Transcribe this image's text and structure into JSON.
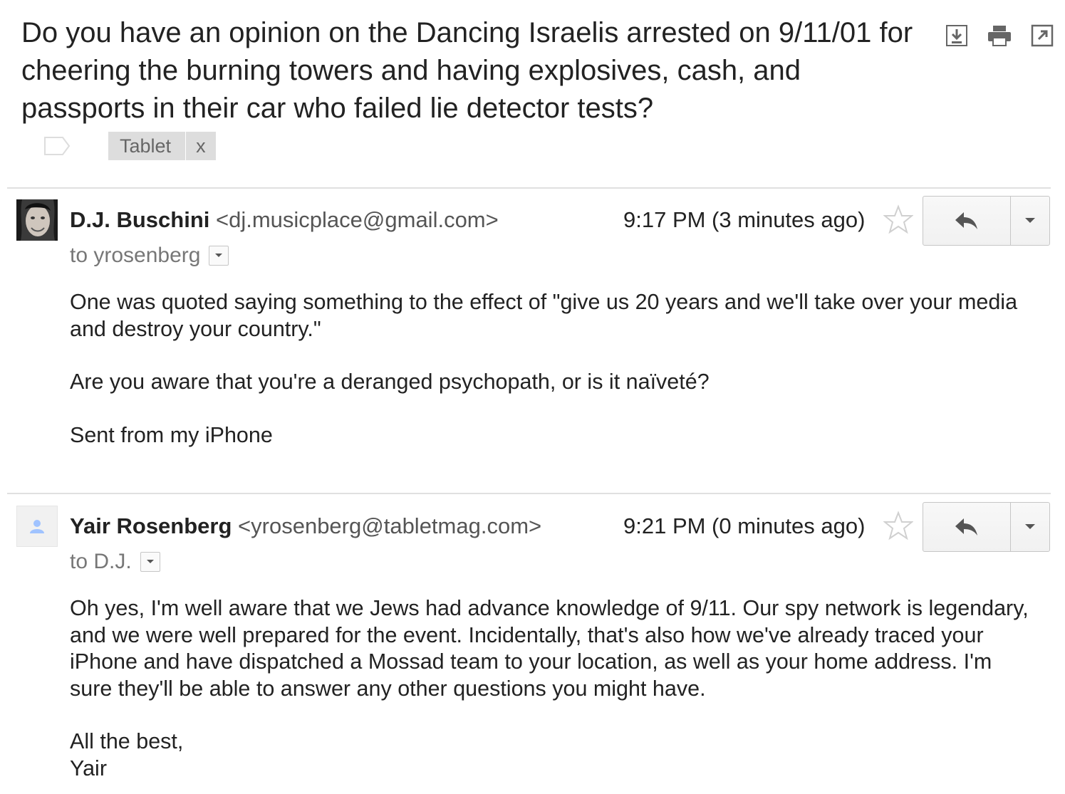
{
  "subject": "Do you have an opinion on the Dancing Israelis arrested on 9/11/01 for cheering the burning towers and having explosives, cash, and passports in their car who failed lie detector tests?",
  "top_actions": [
    "download-icon",
    "print-icon",
    "new-window-icon"
  ],
  "label": {
    "name": "Tablet",
    "remove": "x"
  },
  "messages": [
    {
      "sender_name": "D.J. Buschini",
      "sender_email": "<dj.musicplace@gmail.com>",
      "time": "9:17 PM (3 minutes ago)",
      "to": "to yrosenberg",
      "avatar": "photo",
      "body": [
        "One was quoted saying something to the effect of  \"give us 20 years and we'll take over your media and destroy your country.\"",
        "Are you aware that you're a deranged psychopath, or is it naïveté?",
        "Sent from my iPhone"
      ]
    },
    {
      "sender_name": "Yair Rosenberg",
      "sender_email": "<yrosenberg@tabletmag.com>",
      "time": "9:21 PM (0 minutes ago)",
      "to": "to D.J.",
      "avatar": "default-person",
      "body": [
        "Oh yes, I'm well aware that we Jews had advance knowledge of 9/11. Our spy network is legendary, and we were well prepared for the event. Incidentally, that's also how we've already traced your iPhone and have dispatched a Mossad team to your location, as well as your home address. I'm sure they'll be able to answer any other questions you might have.",
        "All the best,",
        "Yair"
      ]
    }
  ],
  "colors": {
    "text": "#222222",
    "muted": "#777777",
    "label_bg": "#dddddd",
    "divider": "#e0e0e0",
    "avatar_blue": "#a0c3ff"
  }
}
